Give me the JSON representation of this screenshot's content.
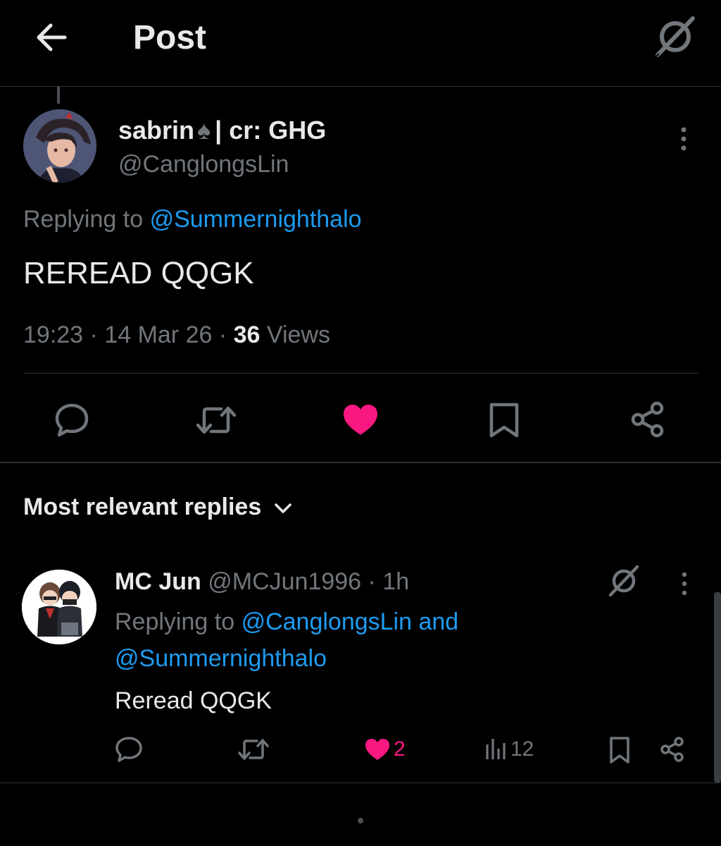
{
  "header": {
    "title": "Post"
  },
  "post": {
    "display_name": "sabrin",
    "name_suffix": "| cr: GHG",
    "handle": "@CanglongsLin",
    "replying_label": "Replying to",
    "replying_to": "@Summernighthalo",
    "text": "REREAD QQGK",
    "time": "19:23",
    "date": "14 Mar 26",
    "views_count": "36",
    "views_label": "Views",
    "liked": true
  },
  "replies_section": {
    "sort_label": "Most relevant replies"
  },
  "reply": {
    "display_name": "MC Jun",
    "handle": "@MCJun1996",
    "time_ago": "1h",
    "replying_label": "Replying to",
    "replying_to_1": "@CanglongsLin and",
    "replying_to_2": "@Summernighthalo",
    "text": "Reread QQGK",
    "likes": "2",
    "views": "12"
  },
  "colors": {
    "background": "#000000",
    "text": "#e7e9ea",
    "muted": "#71767b",
    "link": "#1d9bf0",
    "like": "#f91880",
    "divider": "#2f3336"
  },
  "icons": {
    "back": "arrow-left-icon",
    "grok": "grok-icon",
    "more": "more-vertical-icon",
    "reply": "comment-icon",
    "repost": "repost-icon",
    "like": "heart-icon",
    "bookmark": "bookmark-icon",
    "share": "share-icon",
    "views": "analytics-icon",
    "chevron": "chevron-down-icon"
  }
}
